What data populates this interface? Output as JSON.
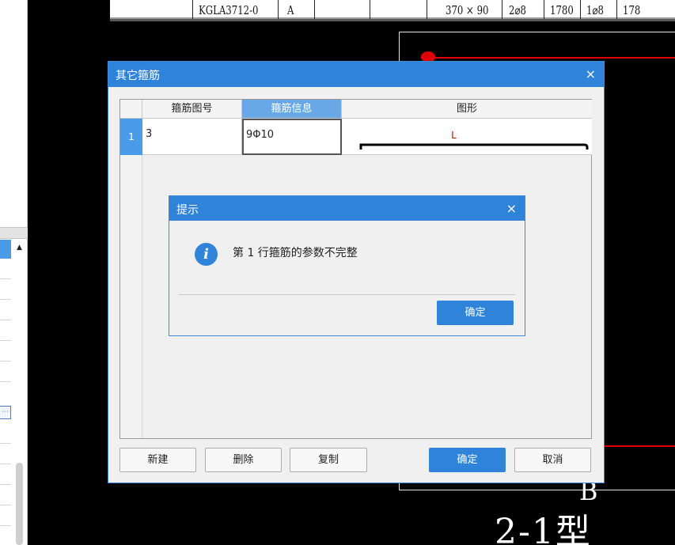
{
  "cad": {
    "table_code": "KGLA3712-0",
    "table_col2": "A",
    "table_size": "370 × 90",
    "table_main": "2⌀8",
    "table_len": "1780",
    "table_stirrup": "1⌀8",
    "table_len2": "178",
    "text_b": "B",
    "text_type": "2-1型"
  },
  "main_dialog": {
    "title": "其它箍筋",
    "close": "×",
    "columns": [
      "箍筋图号",
      "箍筋信息",
      "图形"
    ],
    "rows": [
      {
        "num": "1",
        "shape_no": "3",
        "info": "9Φ10",
        "shape_label": "L"
      }
    ],
    "buttons": {
      "new": "新建",
      "delete": "删除",
      "copy": "复制",
      "ok": "确定",
      "cancel": "取消"
    }
  },
  "hint_dialog": {
    "title": "提示",
    "close": "×",
    "icon": "info-icon",
    "message": "第 1 行箍筋的参数不完整",
    "ok": "确定"
  },
  "left_panel": {
    "button_icon": "ellipsis-icon"
  },
  "colors": {
    "titlebar": "#2f83d9",
    "selection": "#4a9be8",
    "cad_red": "#e00000"
  }
}
